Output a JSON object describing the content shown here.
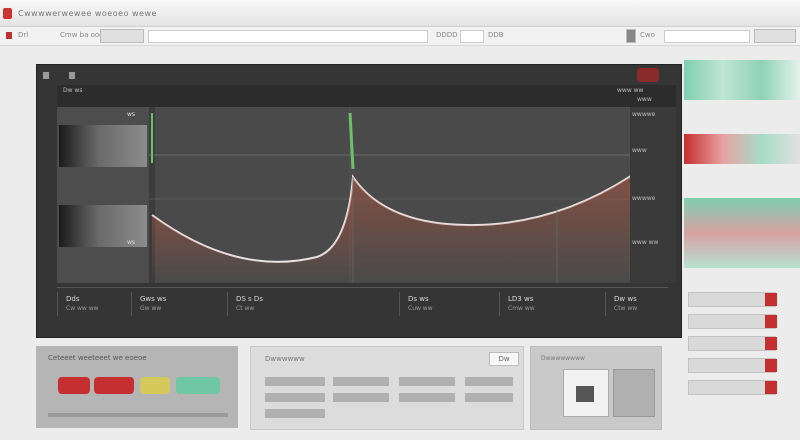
{
  "window": {
    "title": "Cwwwwerwewee woeoeo wewe"
  },
  "toolbar": {
    "item1": "Drl",
    "item2": "Cmw ba ooooo",
    "field1": "DDDD",
    "field2": "DDB",
    "field3": "Cwo"
  },
  "panel": {
    "header_left": "Dw ws",
    "header_right_top": "www ww",
    "header_right_bottom": "www",
    "side_label1": "ws",
    "side_label2": "ws",
    "axis_labels": [
      "wwwwe",
      "www",
      "wwwwe",
      "www ww"
    ]
  },
  "status": [
    {
      "value": "Dds",
      "sub": "Cw ww ww"
    },
    {
      "value": "Gws ws",
      "sub": "Gw ww"
    },
    {
      "value": "DS s Ds",
      "sub": "Ct ww"
    },
    {
      "value": "Ds ws",
      "sub": "Cuw ww"
    },
    {
      "value": "LD3 ws",
      "sub": "Cmw ww"
    },
    {
      "value": "Dw ws",
      "sub": "Ctw ww"
    }
  ],
  "bottom_left": {
    "title": "Ceteeet weeteeet we eoeoe"
  },
  "bottom_mid": {
    "title": "Dwwwwww",
    "button": "Dw"
  },
  "bottom_right": {
    "title": "Dwwwwwwww"
  },
  "colors": {
    "accent_red": "#c62f2f",
    "accent_green": "#6fc7a5",
    "accent_yellow": "#d4c95a"
  }
}
